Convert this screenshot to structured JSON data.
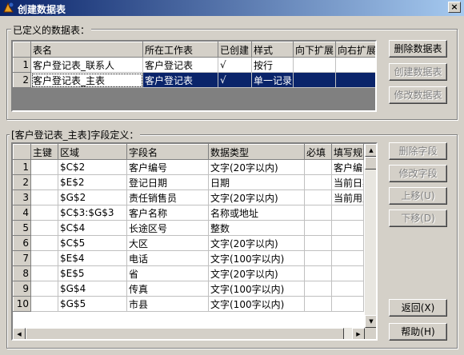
{
  "window": {
    "title": "创建数据表",
    "close_glyph": "×"
  },
  "tables_group": {
    "legend": "已定义的数据表：",
    "columns": [
      "表名",
      "所在工作表",
      "已创建",
      "样式",
      "向下扩展",
      "向右扩展"
    ],
    "rows": [
      {
        "num": "1",
        "name": "客户登记表_联系人",
        "sheet": "客户登记表",
        "created": "√",
        "style": "按行",
        "down": "",
        "right": ""
      },
      {
        "num": "2",
        "name": "客户登记表_主表",
        "sheet": "客户登记表",
        "created": "√",
        "style": "单一记录",
        "down": "",
        "right": ""
      }
    ],
    "buttons": {
      "delete": "删除数据表",
      "create": "创建数据表",
      "modify": "修改数据表"
    }
  },
  "fields_group": {
    "legend": "[客户登记表_主表]字段定义：",
    "columns": [
      "主键",
      "区域",
      "字段名",
      "数据类型",
      "必填",
      "填写规范"
    ],
    "rows": [
      {
        "num": "1",
        "pk": "",
        "area": "$C$2",
        "field": "客户编号",
        "type": "文字(20字以内)",
        "required": "",
        "rule": "客户编号"
      },
      {
        "num": "2",
        "pk": "",
        "area": "$E$2",
        "field": "登记日期",
        "type": "日期",
        "required": "",
        "rule": "当前日期"
      },
      {
        "num": "3",
        "pk": "",
        "area": "$G$2",
        "field": "责任销售员",
        "type": "文字(20字以内)",
        "required": "",
        "rule": "当前用户"
      },
      {
        "num": "4",
        "pk": "",
        "area": "$C$3:$G$3",
        "field": "客户名称",
        "type": "名称或地址",
        "required": "",
        "rule": ""
      },
      {
        "num": "5",
        "pk": "",
        "area": "$C$4",
        "field": "长途区号",
        "type": "整数",
        "required": "",
        "rule": ""
      },
      {
        "num": "6",
        "pk": "",
        "area": "$C$5",
        "field": "大区",
        "type": "文字(20字以内)",
        "required": "",
        "rule": ""
      },
      {
        "num": "7",
        "pk": "",
        "area": "$E$4",
        "field": "电话",
        "type": "文字(100字以内)",
        "required": "",
        "rule": ""
      },
      {
        "num": "8",
        "pk": "",
        "area": "$E$5",
        "field": "省",
        "type": "文字(20字以内)",
        "required": "",
        "rule": ""
      },
      {
        "num": "9",
        "pk": "",
        "area": "$G$4",
        "field": "传真",
        "type": "文字(100字以内)",
        "required": "",
        "rule": ""
      },
      {
        "num": "10",
        "pk": "",
        "area": "$G$5",
        "field": "市县",
        "type": "文字(100字以内)",
        "required": "",
        "rule": ""
      }
    ],
    "buttons": {
      "delete": "删除字段",
      "modify": "修改字段",
      "up": "上移(U)",
      "down": "下移(D)"
    }
  },
  "footer_buttons": {
    "back": "返回(X)",
    "help": "帮助(H)"
  },
  "colors": {
    "title_start": "#0a246a",
    "title_end": "#a6caf0",
    "selection": "#0a246a",
    "face": "#d4d0c8"
  }
}
